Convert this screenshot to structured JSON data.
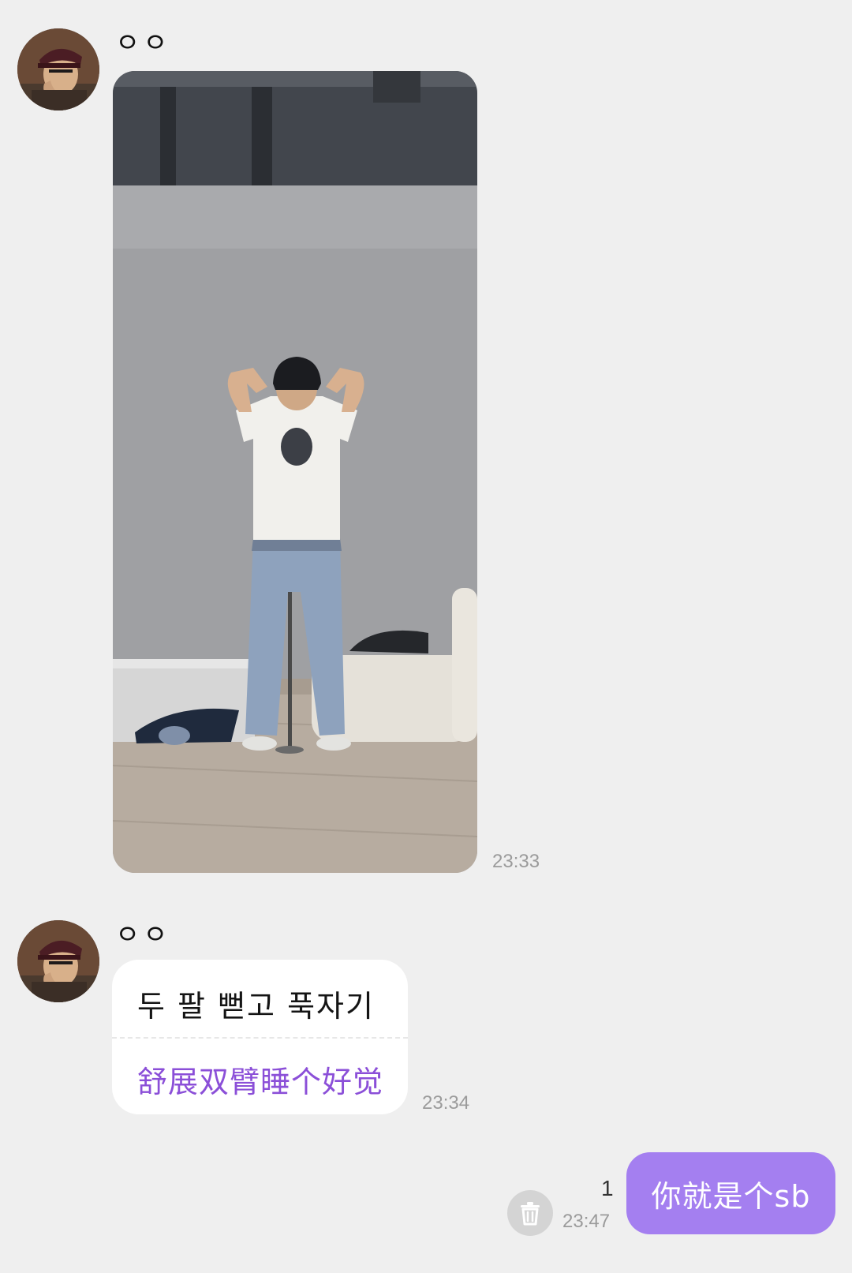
{
  "messages": [
    {
      "sender": "ㅇㅇ",
      "type": "image",
      "time": "23:33"
    },
    {
      "sender": "ㅇㅇ",
      "type": "text",
      "original": "두 팔 뻗고 푹자기",
      "translation": "舒展双臂睡个好觉",
      "time": "23:34"
    },
    {
      "sender": "me",
      "type": "text",
      "text": "你就是个sb",
      "time": "23:47",
      "unread_count": "1"
    }
  ],
  "colors": {
    "background": "#efefef",
    "received_bubble": "#ffffff",
    "sent_bubble": "#a47ff0",
    "translation_text": "#8b4fd8",
    "timestamp": "#9b9b9b"
  },
  "icons": {
    "delete": "trash-icon"
  }
}
